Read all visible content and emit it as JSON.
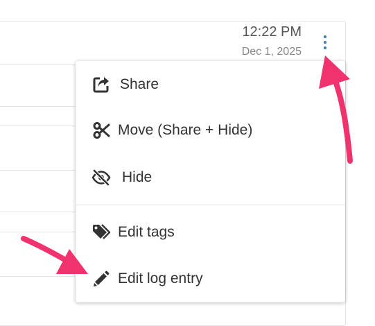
{
  "entry": {
    "time": "12:22 PM",
    "date": "Dec 1, 2025"
  },
  "menu": {
    "items": [
      {
        "label": "Share",
        "icon": "share-square-icon"
      },
      {
        "label": "Move (Share + Hide)",
        "icon": "scissors-icon"
      },
      {
        "label": "Hide",
        "icon": "eye-slash-icon"
      },
      {
        "label": "Edit tags",
        "icon": "tags-icon"
      },
      {
        "label": "Edit log entry",
        "icon": "pencil-icon"
      }
    ]
  },
  "colors": {
    "accent": "#3b7ab8",
    "annotation_arrow": "#f0326e",
    "text": "#333333"
  }
}
